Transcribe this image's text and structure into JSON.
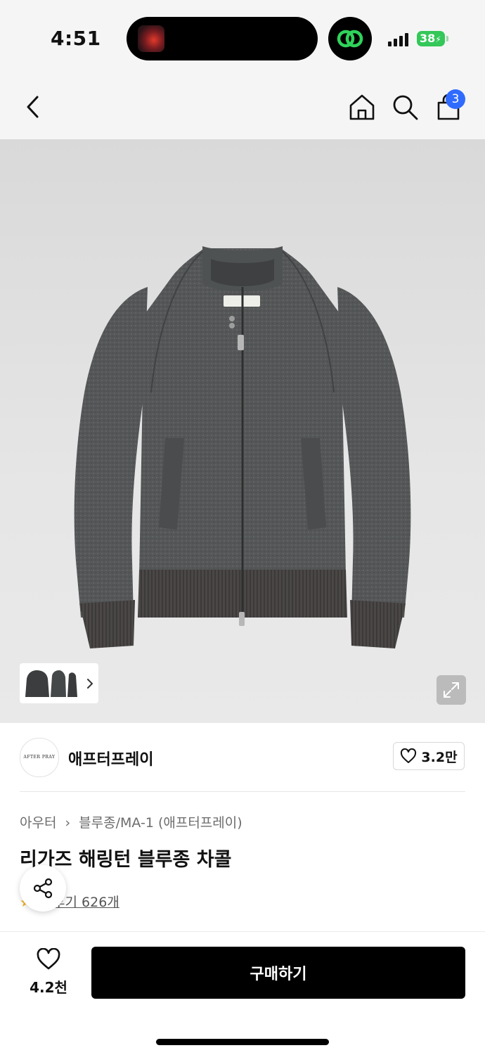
{
  "status_bar": {
    "time": "4:51",
    "battery": "38"
  },
  "nav": {
    "cart_count": "3"
  },
  "product_image": {
    "thumb_count": 3
  },
  "brand": {
    "logo_text": "AFTER PRAY",
    "name": "애프터프레이",
    "likes": "3.2만"
  },
  "breadcrumb": {
    "category": "아우터",
    "subcategory": "블루종/MA-1 (애프터프레이)"
  },
  "product": {
    "title": "리가즈 해링턴 블루종 차콜",
    "reviews": "후기 626개"
  },
  "bottom_bar": {
    "wish_count": "4.2천",
    "buy_label": "구매하기"
  },
  "colors": {
    "accent_badge": "#2f6bff",
    "battery_green": "#34c759",
    "review_star": "#f2b01e"
  }
}
